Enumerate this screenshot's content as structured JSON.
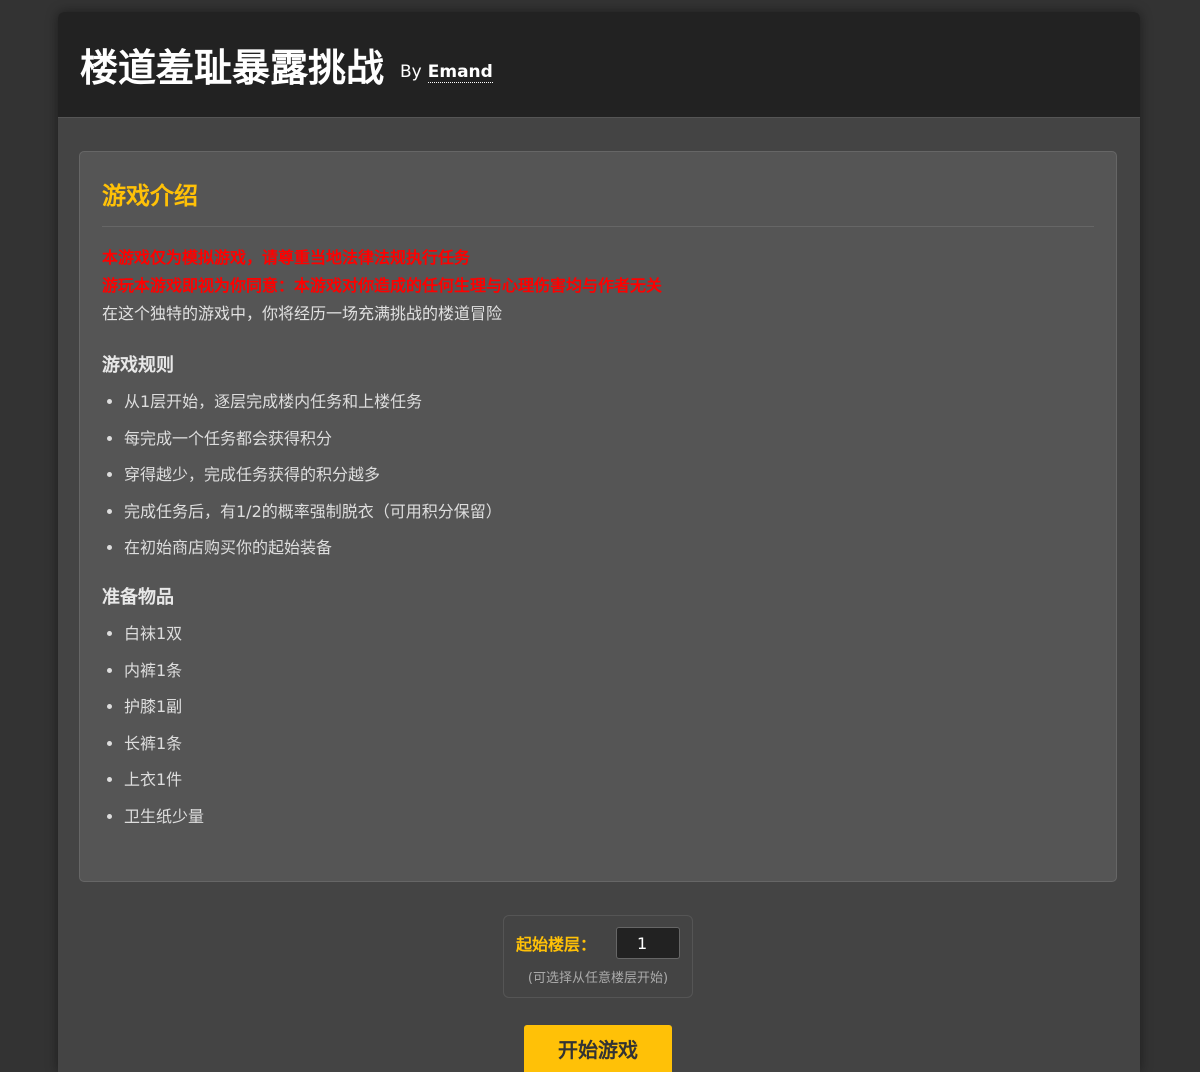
{
  "header": {
    "title": "楼道羞耻暴露挑战",
    "by_label": "By",
    "author": "Emand"
  },
  "intro_card": {
    "heading": "游戏介绍",
    "warnings": [
      "本游戏仅为模拟游戏，请尊重当地法律法规执行任务",
      "游玩本游戏即视为你同意：本游戏对你造成的任何生理与心理伤害均与作者无关"
    ],
    "description": "在这个独特的游戏中，你将经历一场充满挑战的楼道冒险",
    "rules": {
      "heading": "游戏规则",
      "items": [
        "从1层开始，逐层完成楼内任务和上楼任务",
        "每完成一个任务都会获得积分",
        "穿得越少，完成任务获得的积分越多",
        "完成任务后，有1/2的概率强制脱衣（可用积分保留）",
        "在初始商店购买你的起始装备"
      ]
    },
    "items": {
      "heading": "准备物品",
      "items": [
        "白袜1双",
        "内裤1条",
        "护膝1副",
        "长裤1条",
        "上衣1件",
        "卫生纸少量"
      ]
    }
  },
  "start_floor": {
    "label": "起始楼层：",
    "value": "1",
    "hint": "(可选择从任意楼层开始)"
  },
  "start_button": {
    "label": "开始游戏"
  },
  "colors": {
    "accent": "#ffc107",
    "warning": "#ff0000",
    "background": "#333333"
  }
}
